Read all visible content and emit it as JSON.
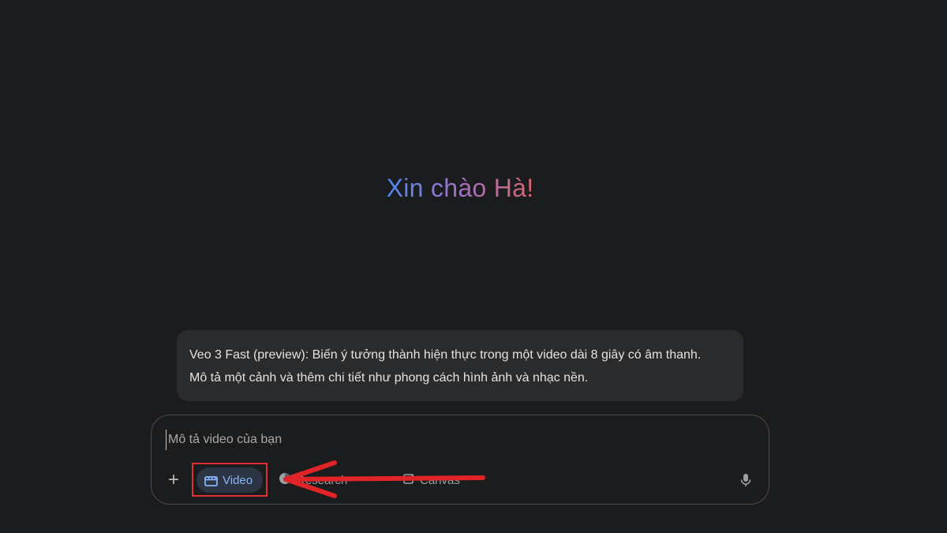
{
  "greeting": "Xin chào Hà!",
  "info_card": {
    "line1": "Veo 3 Fast (preview): Biến ý tưởng thành hiện thực trong một video dài 8 giây có âm thanh.",
    "line2": "Mô tả một cảnh và thêm chi tiết như phong cách hình ảnh và nhạc nền."
  },
  "prompt": {
    "placeholder": "Mô tả video của bạn",
    "value": ""
  },
  "toolbar": {
    "plus_label": "+",
    "video_label": "Video",
    "research_label": "Research",
    "canvas_label": "Canvas"
  },
  "icons": {
    "video": "film-icon",
    "research": "deep-research-icon",
    "canvas": "canvas-icon",
    "mic": "mic-icon"
  },
  "colors": {
    "background": "#1b1c1d",
    "accent": "#8ab4f8",
    "annotation": "#e03032",
    "greeting_gradient": [
      "#4a8bf5",
      "#9b72cb",
      "#d96570"
    ]
  }
}
